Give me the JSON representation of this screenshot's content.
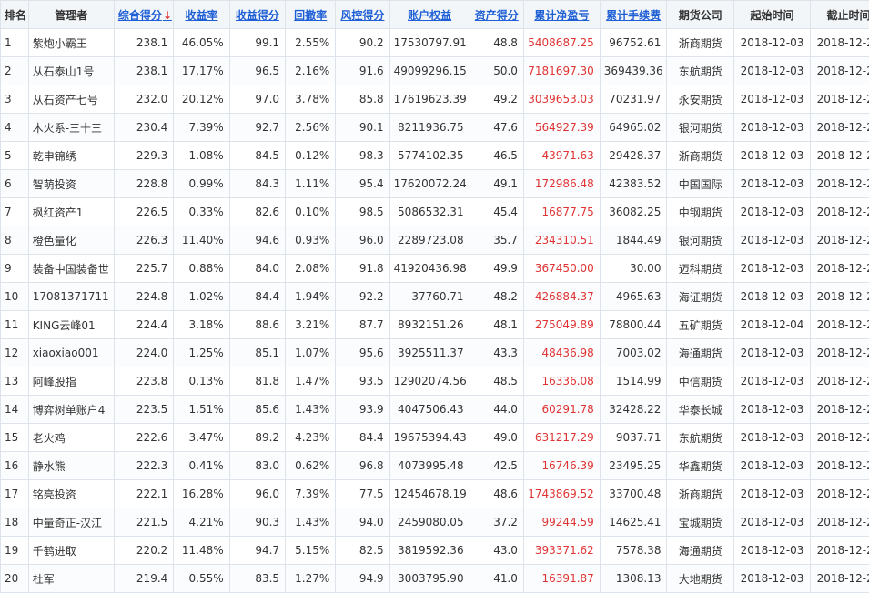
{
  "header": {
    "rank": "排名",
    "manager": "管理者",
    "composite": "综合得分",
    "sort_arrow": "↓",
    "return_rate": "收益率",
    "return_score": "收益得分",
    "drawdown": "回撤率",
    "risk_score": "风控得分",
    "equity": "账户权益",
    "asset_score": "资产得分",
    "cum_pnl": "累计净盈亏",
    "cum_fee": "累计手续费",
    "broker": "期货公司",
    "start": "起始时间",
    "end": "截止时间"
  },
  "colors": {
    "link": "#1f5fd6",
    "pnl": "#e03333",
    "sort_arrow": "#e03333",
    "header_bg": "#f3f6f9",
    "border": "#dde3ea"
  },
  "rows": [
    {
      "rank": "1",
      "manager": "紫炮小霸王",
      "composite": "238.1",
      "return_rate": "46.05%",
      "return_score": "99.1",
      "drawdown": "2.55%",
      "risk_score": "90.2",
      "equity": "17530797.91",
      "asset_score": "48.8",
      "cum_pnl": "5408687.25",
      "cum_fee": "96752.61",
      "broker": "浙商期货",
      "start": "2018-12-03",
      "end": "2018-12-25"
    },
    {
      "rank": "2",
      "manager": "从石泰山1号",
      "composite": "238.1",
      "return_rate": "17.17%",
      "return_score": "96.5",
      "drawdown": "2.16%",
      "risk_score": "91.6",
      "equity": "49099296.15",
      "asset_score": "50.0",
      "cum_pnl": "7181697.30",
      "cum_fee": "369439.36",
      "broker": "东航期货",
      "start": "2018-12-03",
      "end": "2018-12-24"
    },
    {
      "rank": "3",
      "manager": "从石资产七号",
      "composite": "232.0",
      "return_rate": "20.12%",
      "return_score": "97.0",
      "drawdown": "3.78%",
      "risk_score": "85.8",
      "equity": "17619623.39",
      "asset_score": "49.2",
      "cum_pnl": "3039653.03",
      "cum_fee": "70231.97",
      "broker": "永安期货",
      "start": "2018-12-03",
      "end": "2018-12-25"
    },
    {
      "rank": "4",
      "manager": "木火系-三十三",
      "composite": "230.4",
      "return_rate": "7.39%",
      "return_score": "92.7",
      "drawdown": "2.56%",
      "risk_score": "90.1",
      "equity": "8211936.75",
      "asset_score": "47.6",
      "cum_pnl": "564927.39",
      "cum_fee": "64965.02",
      "broker": "银河期货",
      "start": "2018-12-03",
      "end": "2018-12-25"
    },
    {
      "rank": "5",
      "manager": "乾申锦绣",
      "composite": "229.3",
      "return_rate": "1.08%",
      "return_score": "84.5",
      "drawdown": "0.12%",
      "risk_score": "98.3",
      "equity": "5774102.35",
      "asset_score": "46.5",
      "cum_pnl": "43971.63",
      "cum_fee": "29428.37",
      "broker": "浙商期货",
      "start": "2018-12-03",
      "end": "2018-12-25"
    },
    {
      "rank": "6",
      "manager": "智萌投资",
      "composite": "228.8",
      "return_rate": "0.99%",
      "return_score": "84.3",
      "drawdown": "1.11%",
      "risk_score": "95.4",
      "equity": "17620072.24",
      "asset_score": "49.1",
      "cum_pnl": "172986.48",
      "cum_fee": "42383.52",
      "broker": "中国国际",
      "start": "2018-12-03",
      "end": "2018-12-25"
    },
    {
      "rank": "7",
      "manager": "枫红资产1",
      "composite": "226.5",
      "return_rate": "0.33%",
      "return_score": "82.6",
      "drawdown": "0.10%",
      "risk_score": "98.5",
      "equity": "5086532.31",
      "asset_score": "45.4",
      "cum_pnl": "16877.75",
      "cum_fee": "36082.25",
      "broker": "中钢期货",
      "start": "2018-12-03",
      "end": "2018-12-25"
    },
    {
      "rank": "8",
      "manager": "橙色量化",
      "composite": "226.3",
      "return_rate": "11.40%",
      "return_score": "94.6",
      "drawdown": "0.93%",
      "risk_score": "96.0",
      "equity": "2289723.08",
      "asset_score": "35.7",
      "cum_pnl": "234310.51",
      "cum_fee": "1844.49",
      "broker": "银河期货",
      "start": "2018-12-03",
      "end": "2018-12-25"
    },
    {
      "rank": "9",
      "manager": "装备中国装备世",
      "composite": "225.7",
      "return_rate": "0.88%",
      "return_score": "84.0",
      "drawdown": "2.08%",
      "risk_score": "91.8",
      "equity": "41920436.98",
      "asset_score": "49.9",
      "cum_pnl": "367450.00",
      "cum_fee": "30.00",
      "broker": "迈科期货",
      "start": "2018-12-03",
      "end": "2018-12-25"
    },
    {
      "rank": "10",
      "manager": "17081371711",
      "composite": "224.8",
      "return_rate": "1.02%",
      "return_score": "84.4",
      "drawdown": "1.94%",
      "risk_score": "92.2",
      "equity": "37760.71",
      "asset_score": "48.2",
      "cum_pnl": "426884.37",
      "cum_fee": "4965.63",
      "broker": "海证期货",
      "start": "2018-12-03",
      "end": "2018-12-25"
    },
    {
      "rank": "11",
      "manager": "KING云峰01",
      "composite": "224.4",
      "return_rate": "3.18%",
      "return_score": "88.6",
      "drawdown": "3.21%",
      "risk_score": "87.7",
      "equity": "8932151.26",
      "asset_score": "48.1",
      "cum_pnl": "275049.89",
      "cum_fee": "78800.44",
      "broker": "五矿期货",
      "start": "2018-12-04",
      "end": "2018-12-25"
    },
    {
      "rank": "12",
      "manager": "xiaoxiao001",
      "composite": "224.0",
      "return_rate": "1.25%",
      "return_score": "85.1",
      "drawdown": "1.07%",
      "risk_score": "95.6",
      "equity": "3925511.37",
      "asset_score": "43.3",
      "cum_pnl": "48436.98",
      "cum_fee": "7003.02",
      "broker": "海通期货",
      "start": "2018-12-03",
      "end": "2018-12-25"
    },
    {
      "rank": "13",
      "manager": "阿峰股指",
      "composite": "223.8",
      "return_rate": "0.13%",
      "return_score": "81.8",
      "drawdown": "1.47%",
      "risk_score": "93.5",
      "equity": "12902074.56",
      "asset_score": "48.5",
      "cum_pnl": "16336.08",
      "cum_fee": "1514.99",
      "broker": "中信期货",
      "start": "2018-12-03",
      "end": "2018-12-25"
    },
    {
      "rank": "14",
      "manager": "博弈树单账户4",
      "composite": "223.5",
      "return_rate": "1.51%",
      "return_score": "85.6",
      "drawdown": "1.43%",
      "risk_score": "93.9",
      "equity": "4047506.43",
      "asset_score": "44.0",
      "cum_pnl": "60291.78",
      "cum_fee": "32428.22",
      "broker": "华泰长城",
      "start": "2018-12-03",
      "end": "2018-12-25"
    },
    {
      "rank": "15",
      "manager": "老火鸡",
      "composite": "222.6",
      "return_rate": "3.47%",
      "return_score": "89.2",
      "drawdown": "4.23%",
      "risk_score": "84.4",
      "equity": "19675394.43",
      "asset_score": "49.0",
      "cum_pnl": "631217.29",
      "cum_fee": "9037.71",
      "broker": "东航期货",
      "start": "2018-12-03",
      "end": "2018-12-25"
    },
    {
      "rank": "16",
      "manager": "静水熊",
      "composite": "222.3",
      "return_rate": "0.41%",
      "return_score": "83.0",
      "drawdown": "0.62%",
      "risk_score": "96.8",
      "equity": "4073995.48",
      "asset_score": "42.5",
      "cum_pnl": "16746.39",
      "cum_fee": "23495.25",
      "broker": "华鑫期货",
      "start": "2018-12-03",
      "end": "2018-12-25"
    },
    {
      "rank": "17",
      "manager": "铭亮投资",
      "composite": "222.1",
      "return_rate": "16.28%",
      "return_score": "96.0",
      "drawdown": "7.39%",
      "risk_score": "77.5",
      "equity": "12454678.19",
      "asset_score": "48.6",
      "cum_pnl": "1743869.52",
      "cum_fee": "33700.48",
      "broker": "浙商期货",
      "start": "2018-12-03",
      "end": "2018-12-25"
    },
    {
      "rank": "18",
      "manager": "中量奇正-汉江",
      "composite": "221.5",
      "return_rate": "4.21%",
      "return_score": "90.3",
      "drawdown": "1.43%",
      "risk_score": "94.0",
      "equity": "2459080.05",
      "asset_score": "37.2",
      "cum_pnl": "99244.59",
      "cum_fee": "14625.41",
      "broker": "宝城期货",
      "start": "2018-12-03",
      "end": "2018-12-25"
    },
    {
      "rank": "19",
      "manager": "千鹤进取",
      "composite": "220.2",
      "return_rate": "11.48%",
      "return_score": "94.7",
      "drawdown": "5.15%",
      "risk_score": "82.5",
      "equity": "3819592.36",
      "asset_score": "43.0",
      "cum_pnl": "393371.62",
      "cum_fee": "7578.38",
      "broker": "海通期货",
      "start": "2018-12-03",
      "end": "2018-12-24"
    },
    {
      "rank": "20",
      "manager": "杜军",
      "composite": "219.4",
      "return_rate": "0.55%",
      "return_score": "83.5",
      "drawdown": "1.27%",
      "risk_score": "94.9",
      "equity": "3003795.90",
      "asset_score": "41.0",
      "cum_pnl": "16391.87",
      "cum_fee": "1308.13",
      "broker": "大地期货",
      "start": "2018-12-03",
      "end": "2018-12-24"
    }
  ]
}
